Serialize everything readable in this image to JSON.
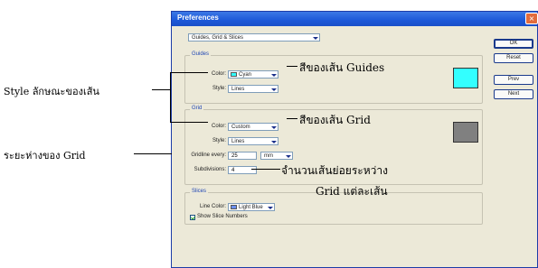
{
  "dialog": {
    "title": "Preferences",
    "close_glyph": "×",
    "section_select": "Guides, Grid & Slices",
    "guides": {
      "group_label": "Guides",
      "color_label": "Color:",
      "color_value": "Cyan",
      "style_label": "Style:",
      "style_value": "Lines",
      "swatch_color": "#33ffff"
    },
    "grid": {
      "group_label": "Grid",
      "color_label": "Color:",
      "color_value": "Custom",
      "style_label": "Style:",
      "style_value": "Lines",
      "gridline_label": "Gridline every:",
      "gridline_value": "25",
      "unit_value": "mm",
      "subdivisions_label": "Subdivisions:",
      "subdivisions_value": "4",
      "swatch_color": "#808080"
    },
    "slices": {
      "group_label": "Slices",
      "line_color_label": "Line Color:",
      "line_color_value": "Light Blue",
      "line_color_swatch": "#6b8ff0",
      "show_numbers_label": "Show Slice Numbers"
    },
    "buttons": {
      "ok": "OK",
      "reset": "Reset",
      "prev": "Prev",
      "next": "Next"
    }
  },
  "annotations": {
    "style": "Style ลักษณะของเส้น",
    "guides_color": "สีของเส้น Guides",
    "grid_color": "สีของเส้น Grid",
    "grid_spacing": "ระยะห่างของ Grid",
    "subdivisions_line1": "จำนวนเส้นย่อยระหว่าง",
    "subdivisions_line2": "Grid แต่ละเส้น"
  }
}
